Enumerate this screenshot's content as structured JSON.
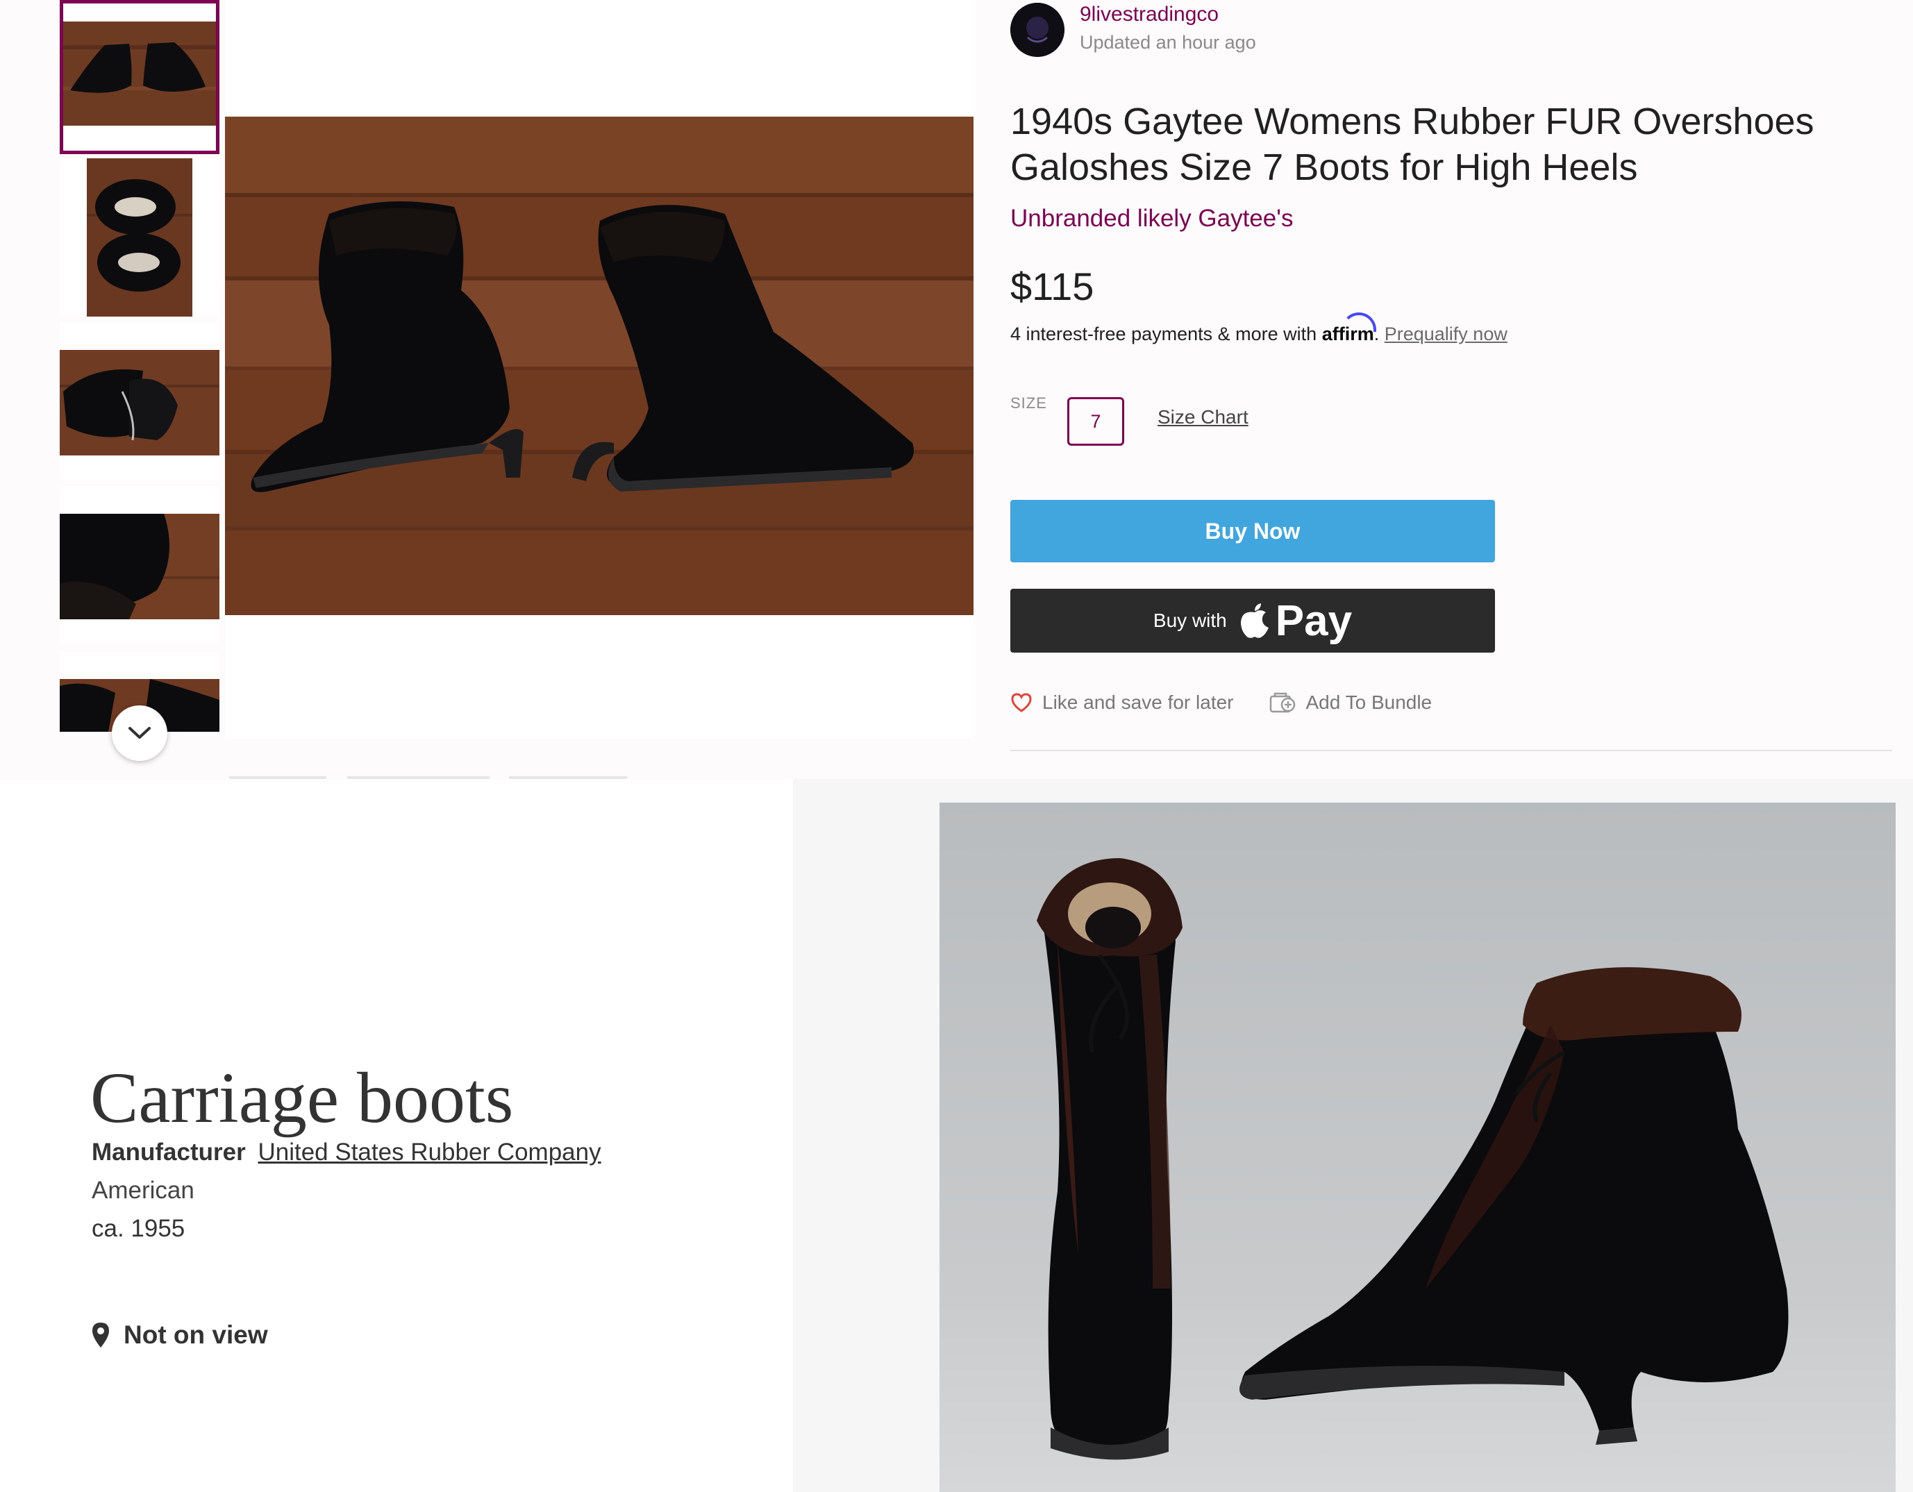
{
  "listing": {
    "seller": {
      "name": "9livestradingco",
      "updated": "Updated an hour ago"
    },
    "title": "1940s Gaytee Womens Rubber FUR Overshoes Galoshes Size 7 Boots for High Heels",
    "brand": "Unbranded likely Gaytee's",
    "price": "$115",
    "affirm": {
      "text": "4 interest-free payments & more with",
      "logo": "affirm",
      "link": "Prequalify now"
    },
    "size": {
      "label": "SIZE",
      "value": "7",
      "chart_link": "Size Chart"
    },
    "buy_now": "Buy Now",
    "apple_pay": {
      "prefix": "Buy with",
      "pay": "Pay"
    },
    "actions": {
      "like": "Like and save for later",
      "bundle": "Add To Bundle"
    },
    "colors": {
      "accent": "#7f0353",
      "buy_button": "#41a6de",
      "apple_button": "#2b2b2b"
    },
    "icons": {
      "thumbs_scroll": "chevron-down-icon",
      "like": "heart-icon",
      "bundle": "bundle-add-icon"
    }
  },
  "museum": {
    "title": "Carriage boots",
    "role": "Manufacturer",
    "maker": "United States Rubber Company",
    "culture": "American",
    "date": "ca. 1955",
    "on_view": "Not on view",
    "icons": {
      "on_view": "map-pin-icon"
    }
  }
}
